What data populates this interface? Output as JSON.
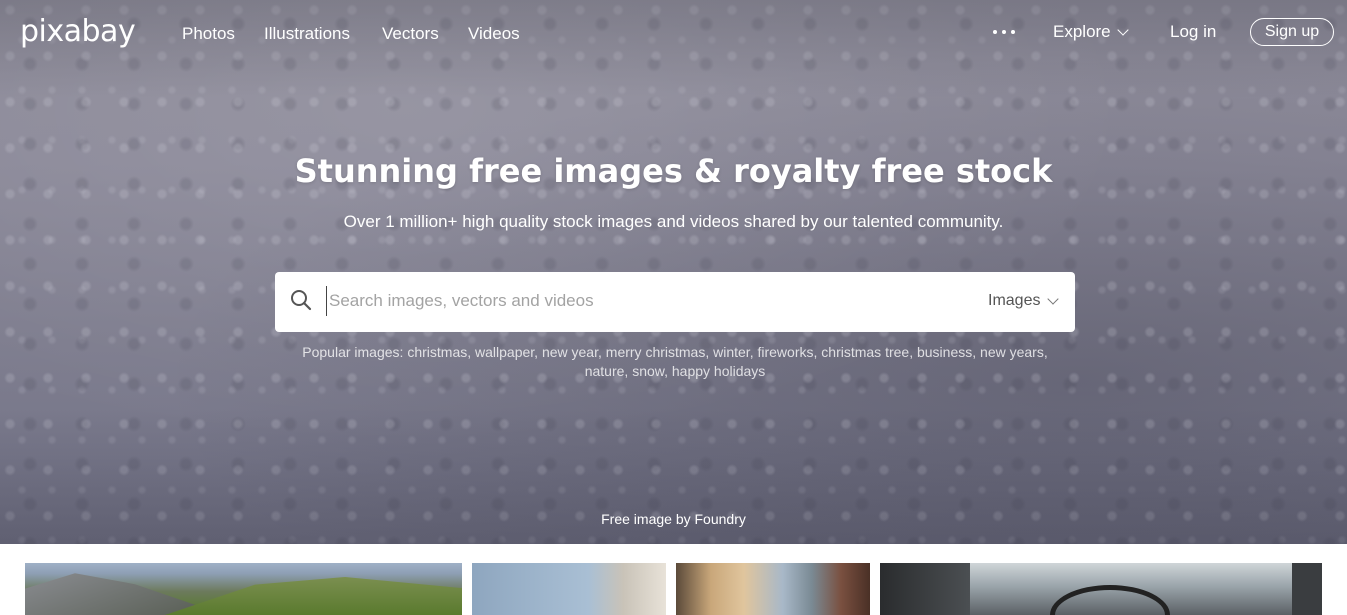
{
  "brand": {
    "logo": "pixabay"
  },
  "nav": {
    "links": [
      "Photos",
      "Illustrations",
      "Vectors",
      "Videos"
    ],
    "more_icon": "more-dots-icon",
    "explore": "Explore",
    "login": "Log in",
    "signup": "Sign up"
  },
  "hero": {
    "headline": "Stunning free images & royalty free stock",
    "subline": "Over 1 million+ high quality stock images and videos shared by our talented community.",
    "credit": "Free image by Foundry"
  },
  "search": {
    "icon": "search-icon",
    "placeholder": "Search images, vectors and videos",
    "value": "",
    "type_selected": "Images"
  },
  "popular": {
    "label": "Popular images:",
    "tags": [
      "christmas",
      "wallpaper",
      "new year",
      "merry christmas",
      "winter",
      "fireworks",
      "christmas tree",
      "business",
      "new years",
      "nature",
      "snow",
      "happy holidays"
    ]
  },
  "colors": {
    "hero_tint": "#8a8898",
    "search_bg": "#ffffff",
    "placeholder": "#a3a3a3"
  }
}
